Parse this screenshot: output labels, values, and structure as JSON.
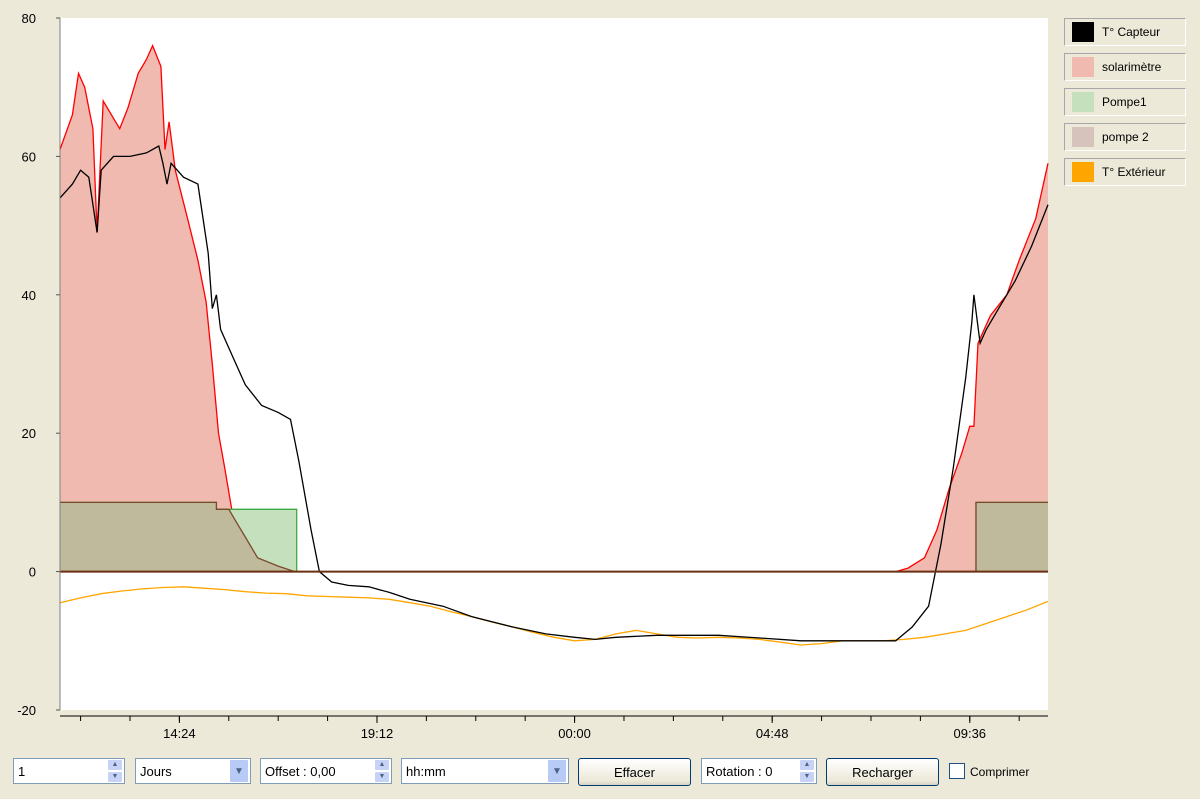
{
  "chart_data": {
    "type": "area",
    "title": "",
    "xlabel": "",
    "ylabel": "",
    "ylim": [
      -20,
      80
    ],
    "yticks": [
      80,
      60,
      40,
      20,
      0,
      -20
    ],
    "xlim_hours": [
      11.5,
      35.5
    ],
    "xticks": [
      {
        "h": 14.4,
        "label": "14:24"
      },
      {
        "h": 19.2,
        "label": "19:12"
      },
      {
        "h": 24.0,
        "label": "00:00"
      },
      {
        "h": 28.8,
        "label": "04:48"
      },
      {
        "h": 33.6,
        "label": "09:36"
      }
    ],
    "x_unit": "time of day (hours since 00:00 of first day)",
    "series": [
      {
        "name": "solarimètre",
        "color": "#ff0000",
        "fill": "#f0bab0",
        "render": "area",
        "points": [
          [
            11.5,
            61
          ],
          [
            11.8,
            66
          ],
          [
            11.95,
            72
          ],
          [
            12.1,
            70
          ],
          [
            12.3,
            64
          ],
          [
            12.4,
            49
          ],
          [
            12.55,
            68
          ],
          [
            12.75,
            66
          ],
          [
            12.95,
            64
          ],
          [
            13.15,
            67
          ],
          [
            13.4,
            72
          ],
          [
            13.6,
            74
          ],
          [
            13.75,
            76
          ],
          [
            13.95,
            73
          ],
          [
            14.05,
            61
          ],
          [
            14.15,
            65
          ],
          [
            14.3,
            58
          ],
          [
            14.6,
            51
          ],
          [
            14.85,
            45
          ],
          [
            15.05,
            39
          ],
          [
            15.2,
            30
          ],
          [
            15.35,
            20
          ],
          [
            15.5,
            15
          ],
          [
            15.7,
            8
          ],
          [
            16.0,
            5
          ],
          [
            16.3,
            2
          ],
          [
            16.8,
            0.8
          ],
          [
            17.2,
            0
          ],
          [
            31.8,
            0
          ],
          [
            32.1,
            0.5
          ],
          [
            32.5,
            2
          ],
          [
            32.8,
            6
          ],
          [
            33.1,
            12
          ],
          [
            33.4,
            17
          ],
          [
            33.6,
            21
          ],
          [
            33.7,
            21
          ],
          [
            33.8,
            33
          ],
          [
            34.1,
            37
          ],
          [
            34.5,
            40
          ],
          [
            34.8,
            45
          ],
          [
            35.2,
            51
          ],
          [
            35.5,
            59
          ]
        ]
      },
      {
        "name": "T° Capteur",
        "color": "#000000",
        "render": "line",
        "points": [
          [
            11.5,
            54
          ],
          [
            11.8,
            56
          ],
          [
            12.0,
            58
          ],
          [
            12.2,
            57
          ],
          [
            12.4,
            49
          ],
          [
            12.5,
            58
          ],
          [
            12.8,
            60
          ],
          [
            13.2,
            60
          ],
          [
            13.6,
            60.5
          ],
          [
            13.9,
            61.5
          ],
          [
            14.0,
            59
          ],
          [
            14.1,
            56
          ],
          [
            14.2,
            59
          ],
          [
            14.5,
            57
          ],
          [
            14.85,
            56
          ],
          [
            15.0,
            50
          ],
          [
            15.1,
            46
          ],
          [
            15.2,
            38
          ],
          [
            15.3,
            40
          ],
          [
            15.4,
            35
          ],
          [
            15.7,
            31
          ],
          [
            16.0,
            27
          ],
          [
            16.4,
            24
          ],
          [
            16.8,
            23
          ],
          [
            17.1,
            22
          ],
          [
            17.3,
            16
          ],
          [
            17.6,
            6
          ],
          [
            17.8,
            0
          ],
          [
            18.1,
            -1.5
          ],
          [
            18.5,
            -2
          ],
          [
            19.0,
            -2.2
          ],
          [
            19.5,
            -3
          ],
          [
            20.0,
            -4
          ],
          [
            20.8,
            -5
          ],
          [
            21.5,
            -6.5
          ],
          [
            22.5,
            -8
          ],
          [
            23.3,
            -9
          ],
          [
            24.0,
            -9.5
          ],
          [
            24.5,
            -9.8
          ],
          [
            25.0,
            -9.5
          ],
          [
            26.0,
            -9.2
          ],
          [
            27.5,
            -9.2
          ],
          [
            28.5,
            -9.6
          ],
          [
            29.5,
            -10
          ],
          [
            31.0,
            -10
          ],
          [
            31.8,
            -10
          ],
          [
            32.2,
            -8
          ],
          [
            32.6,
            -5
          ],
          [
            32.9,
            4
          ],
          [
            33.2,
            15
          ],
          [
            33.5,
            28
          ],
          [
            33.65,
            36
          ],
          [
            33.7,
            40
          ],
          [
            33.85,
            33
          ],
          [
            34.0,
            35
          ],
          [
            34.3,
            38
          ],
          [
            34.7,
            42
          ],
          [
            35.1,
            47
          ],
          [
            35.5,
            53
          ]
        ]
      },
      {
        "name": "Pompe1",
        "color": "#3faa3f",
        "fill": "#c4e0bc",
        "render": "area",
        "points": [
          [
            11.5,
            10
          ],
          [
            15.3,
            10
          ],
          [
            15.3,
            9
          ],
          [
            17.25,
            9
          ],
          [
            17.25,
            0
          ],
          [
            33.75,
            0
          ],
          [
            33.75,
            10
          ],
          [
            35.5,
            10
          ]
        ]
      },
      {
        "name": "pompe 2",
        "color": "#7a4a2a",
        "fill": "#bfb397",
        "render": "area",
        "points": [
          [
            11.5,
            10
          ],
          [
            15.3,
            10
          ],
          [
            15.3,
            9
          ],
          [
            15.6,
            9
          ],
          [
            15.8,
            7
          ],
          [
            16.0,
            5
          ],
          [
            16.3,
            2
          ],
          [
            16.8,
            0.8
          ],
          [
            17.2,
            0
          ],
          [
            33.75,
            0
          ],
          [
            33.75,
            10
          ],
          [
            35.5,
            10
          ]
        ]
      },
      {
        "name": "T° Extérieur",
        "color": "#ffa500",
        "render": "line",
        "points": [
          [
            11.5,
            -4.5
          ],
          [
            12.0,
            -3.8
          ],
          [
            12.5,
            -3.2
          ],
          [
            13.0,
            -2.8
          ],
          [
            13.5,
            -2.5
          ],
          [
            14.0,
            -2.3
          ],
          [
            14.5,
            -2.2
          ],
          [
            15.0,
            -2.4
          ],
          [
            15.5,
            -2.6
          ],
          [
            16.0,
            -2.9
          ],
          [
            16.5,
            -3.1
          ],
          [
            17.0,
            -3.2
          ],
          [
            17.5,
            -3.5
          ],
          [
            18.0,
            -3.6
          ],
          [
            18.5,
            -3.7
          ],
          [
            19.0,
            -3.8
          ],
          [
            19.5,
            -4.0
          ],
          [
            20.0,
            -4.5
          ],
          [
            20.5,
            -5.0
          ],
          [
            21.0,
            -5.8
          ],
          [
            21.5,
            -6.5
          ],
          [
            22.0,
            -7.3
          ],
          [
            22.5,
            -8.0
          ],
          [
            23.0,
            -8.8
          ],
          [
            23.5,
            -9.5
          ],
          [
            24.0,
            -10.0
          ],
          [
            24.5,
            -9.8
          ],
          [
            25.0,
            -9.0
          ],
          [
            25.5,
            -8.5
          ],
          [
            26.0,
            -9.0
          ],
          [
            26.5,
            -9.5
          ],
          [
            27.0,
            -9.6
          ],
          [
            27.5,
            -9.5
          ],
          [
            28.0,
            -9.6
          ],
          [
            28.5,
            -9.8
          ],
          [
            29.0,
            -10.2
          ],
          [
            29.5,
            -10.6
          ],
          [
            30.0,
            -10.4
          ],
          [
            30.5,
            -10.0
          ],
          [
            31.0,
            -10.0
          ],
          [
            31.5,
            -10.0
          ],
          [
            32.0,
            -9.8
          ],
          [
            32.5,
            -9.5
          ],
          [
            33.0,
            -9.0
          ],
          [
            33.5,
            -8.5
          ],
          [
            34.0,
            -7.5
          ],
          [
            34.5,
            -6.5
          ],
          [
            35.0,
            -5.5
          ],
          [
            35.5,
            -4.3
          ]
        ]
      }
    ],
    "legend_position": "right",
    "grid": false
  },
  "legend": [
    {
      "label": "T° Capteur",
      "color": "#000000"
    },
    {
      "label": "solarimètre",
      "color": "#f0bab0"
    },
    {
      "label": "Pompe1",
      "color": "#c4e0bc"
    },
    {
      "label": "pompe 2",
      "color": "#d6c4bc"
    },
    {
      "label": "T° Extérieur",
      "color": "#ffa500"
    }
  ],
  "toolbar": {
    "count_value": "1",
    "period_value": "Jours",
    "offset_value": "Offset : 0,00",
    "format_value": "hh:mm",
    "clear_label": "Effacer",
    "rotation_value": "Rotation : 0",
    "reload_label": "Recharger",
    "compress_label": "Comprimer"
  }
}
